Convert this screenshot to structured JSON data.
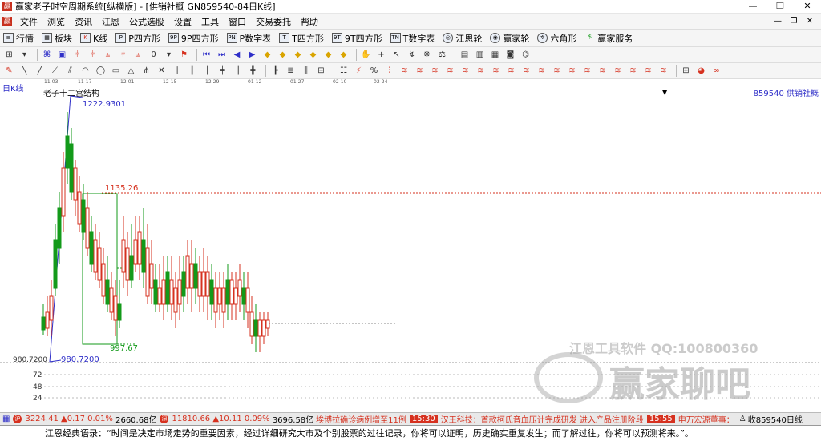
{
  "window": {
    "title": "赢家老子时空周期系统[纵横版] - [供销社概  GN859540-84日K线]",
    "controls": [
      "—",
      "❐",
      "✕"
    ]
  },
  "menu": {
    "items": [
      "文件",
      "浏览",
      "资讯",
      "江恩",
      "公式选股",
      "设置",
      "工具",
      "窗口",
      "交易委托",
      "帮助"
    ],
    "mdi_controls": [
      "—",
      "❐",
      "✕"
    ]
  },
  "toolbar1": {
    "items": [
      {
        "icon": "list-icon",
        "label": "行情"
      },
      {
        "icon": "block-icon",
        "label": "板块"
      },
      {
        "icon": "kline-icon",
        "label": "K线"
      },
      {
        "icon": "p-icon",
        "label": "P四方形"
      },
      {
        "icon": "9p-icon",
        "label": "9P四方形"
      },
      {
        "icon": "pn-icon",
        "label": "P数字表"
      },
      {
        "icon": "t-icon",
        "label": "T四方形"
      },
      {
        "icon": "9t-icon",
        "label": "9T四方形"
      },
      {
        "icon": "tn-icon",
        "label": "T数字表"
      },
      {
        "icon": "wheel-icon",
        "label": "江恩轮"
      },
      {
        "icon": "winner-wheel-icon",
        "label": "赢家轮"
      },
      {
        "icon": "hexagon-icon",
        "label": "六角形"
      },
      {
        "icon": "dollar-icon",
        "label": "赢家服务"
      }
    ]
  },
  "chart": {
    "period_label": "日K线",
    "study_label": "老子十二宫结构",
    "code_label": "859540 供销社概",
    "price_high": "1222.9301",
    "price_level": "1135.26",
    "price_box_low": "997.67",
    "price_low": "980.7200",
    "axis_value": "980.7200",
    "volume_ticks": [
      "72",
      "48",
      "24"
    ],
    "dates": [
      "11-03",
      "11-17",
      "12-01",
      "12-15",
      "12-29",
      "01-12",
      "01-27",
      "02-10",
      "02-24"
    ],
    "colors": {
      "up": "#d6311f",
      "down": "#139a1a",
      "blue": "#2f2fc8",
      "level": "#d6311f"
    }
  },
  "chart_data": {
    "type": "candlestick",
    "title": "老子十二宫结构",
    "high_label": 1222.9301,
    "low_label": 980.72,
    "resistance": 1135.26,
    "box_low": 997.67
  },
  "watermark": {
    "line1": "江恩工具软件  QQ:100800360",
    "line2": "赢家聊吧"
  },
  "statusbar": {
    "index1_value": "3224.41",
    "index1_change": "▲0.17 0.01%",
    "index1_amount": "2660.68亿",
    "index2_value": "11810.66",
    "index2_change": "▲10.11 0.09%",
    "index2_amount": "3696.58亿",
    "news1": "埃博拉确诊病例增至11例",
    "news2_time": "15:30",
    "news2": "汉王科技：首款柯氏音血压计完成研发 进入产品注册阶段",
    "news3_time": "15:55",
    "news3": "申万宏源董事：",
    "code_tail": "收859540日线"
  },
  "quote": {
    "text": "江恩经典语录：“时间是决定市场走势的重要因素，经过详细研究大市及个别股票的过往记录，你将可以证明，历史确实重复发生；而了解过往，你将可以预测将来。”。"
  }
}
